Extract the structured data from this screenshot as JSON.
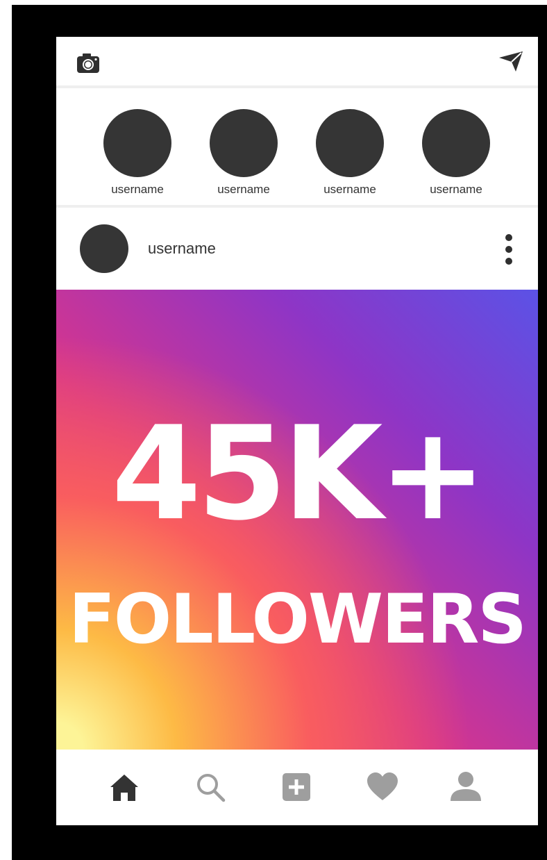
{
  "header": {
    "left_icon": "camera-icon",
    "right_icon": "send-icon"
  },
  "stories": [
    {
      "username": "username"
    },
    {
      "username": "username"
    },
    {
      "username": "username"
    },
    {
      "username": "username"
    }
  ],
  "post": {
    "username": "username",
    "menu_icon": "more-vertical-icon",
    "headline": "45K+",
    "subheadline": "FOLLOWERS",
    "gradient_colors": [
      "#fdf497",
      "#fdba45",
      "#f95d5f",
      "#d6358d",
      "#8e35c6",
      "#5b52e6"
    ]
  },
  "bottom_nav": [
    {
      "icon": "home-icon",
      "color": "#333333"
    },
    {
      "icon": "search-icon",
      "color": "#9e9e9e"
    },
    {
      "icon": "add-post-icon",
      "color": "#9e9e9e"
    },
    {
      "icon": "heart-icon",
      "color": "#9e9e9e"
    },
    {
      "icon": "profile-icon",
      "color": "#9e9e9e"
    }
  ]
}
